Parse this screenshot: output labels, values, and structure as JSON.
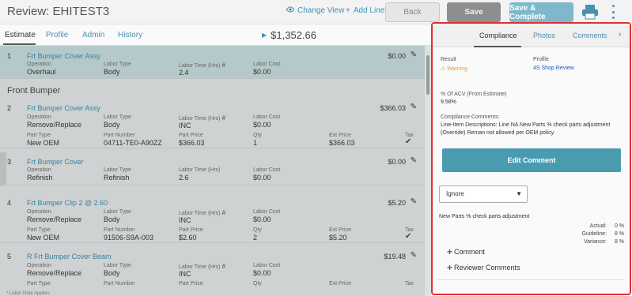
{
  "header": {
    "title": "Review: EHITEST3",
    "change_view": "Change View",
    "add_line": "Add Line",
    "back": "Back",
    "save": "Save",
    "save_complete": "Save & Complete"
  },
  "tabs": {
    "items": [
      "Estimate",
      "Profile",
      "Admin",
      "History"
    ],
    "total": "$1,352.66"
  },
  "estimate": {
    "section_front_bumper": "Front Bumper",
    "rows": [
      {
        "num": "1",
        "title": "Frt Bumper Cover Assy",
        "price": "$0.00",
        "operation_label": "Operation",
        "operation": "Overhaul",
        "labor_type_label": "Labor Type",
        "labor_type": "Body",
        "labor_time_label": "Labor Time (Hrs)",
        "labor_time": "2.4",
        "labor_cost_label": "Labor Cost",
        "labor_cost": "$0.00"
      },
      {
        "num": "2",
        "title": "Frt Bumper Cover Assy",
        "price": "$366.03",
        "operation_label": "Operation",
        "operation": "Remove/Replace",
        "labor_type_label": "Labor Type",
        "labor_type": "Body",
        "labor_time_label": "Labor Time (Hrs)",
        "labor_time": "INC",
        "labor_cost_label": "Labor Cost",
        "labor_cost": "$0.00",
        "part_type_label": "Part Type",
        "part_type": "New OEM",
        "part_number_label": "Part Number",
        "part_number": "04711-TE0-A90ZZ",
        "part_price_label": "Part Price",
        "part_price": "$366.03",
        "qty_label": "Qty",
        "qty": "1",
        "ext_price_label": "Ext Price",
        "ext_price": "$366.03",
        "tax_label": "Tax"
      },
      {
        "num": "3",
        "title": "Frt Bumper Cover",
        "price": "$0.00",
        "operation_label": "Operation",
        "operation": "Refinish",
        "labor_type_label": "Labor Type",
        "labor_type": "Refinish",
        "labor_time_label": "Labor Time (Hrs)",
        "labor_time": "2.6",
        "labor_cost_label": "Labor Cost",
        "labor_cost": "$0.00"
      },
      {
        "num": "4",
        "title": "Frt Bumper Clip 2 @ 2.60",
        "price": "$5.20",
        "operation_label": "Operation",
        "operation": "Remove/Replace",
        "labor_type_label": "Labor Type",
        "labor_type": "Body",
        "labor_time_label": "Labor Time (Hrs)",
        "labor_time": "INC",
        "labor_cost_label": "Labor Cost",
        "labor_cost": "$0.00",
        "part_type_label": "Part Type",
        "part_type": "New OEM",
        "part_number_label": "Part Number",
        "part_number": "91506-S9A-003",
        "part_price_label": "Part Price",
        "part_price": "$2.60",
        "qty_label": "Qty",
        "qty": "2",
        "ext_price_label": "Ext Price",
        "ext_price": "$5.20",
        "tax_label": "Tax"
      },
      {
        "num": "5",
        "title": "R Frt Bumper Cover Beam",
        "price": "$19.48",
        "operation_label": "Operation",
        "operation": "Remove/Replace",
        "labor_type_label": "Labor Type",
        "labor_type": "Body",
        "labor_time_label": "Labor Time (Hrs)",
        "labor_time": "INC",
        "labor_cost_label": "Labor Cost",
        "labor_cost": "$0.00",
        "part_type_label": "Part Type",
        "part_number_label": "Part Number",
        "part_price_label": "Part Price",
        "qty_label": "Qty",
        "ext_price_label": "Ext Price",
        "tax_label": "Tax"
      }
    ],
    "footer": "Labor Note Applies"
  },
  "compliance": {
    "tabs": [
      "Compliance",
      "Photos",
      "Comments"
    ],
    "result_label": "Result",
    "result": "Warning",
    "profile_label": "Profile",
    "profile": "4S Shop Review",
    "acv_label": "% Of ACV (From Estimate)",
    "acv": "9.58%",
    "comments_label": "Compliance Comments:",
    "comments": "Line-Item Descriptions: Line NA New Parts % check parts adjustment (Override) Reman not allowed per OEM policy.",
    "edit_comment": "Edit Comment",
    "select_value": "Ignore",
    "rule": "New Parts % check parts adjustment",
    "actual_label": "Actual:",
    "actual": "0 %",
    "guideline_label": "Guideline:",
    "guideline": "8 %",
    "variance_label": "Variance:",
    "variance": "8 %",
    "add_comment": "Comment",
    "add_reviewer": "Reviewer Comments"
  },
  "colors": {
    "accent": "#4a9bb0",
    "highlight": "#e03030",
    "warning": "#e0a030",
    "link": "#3f91b5"
  }
}
